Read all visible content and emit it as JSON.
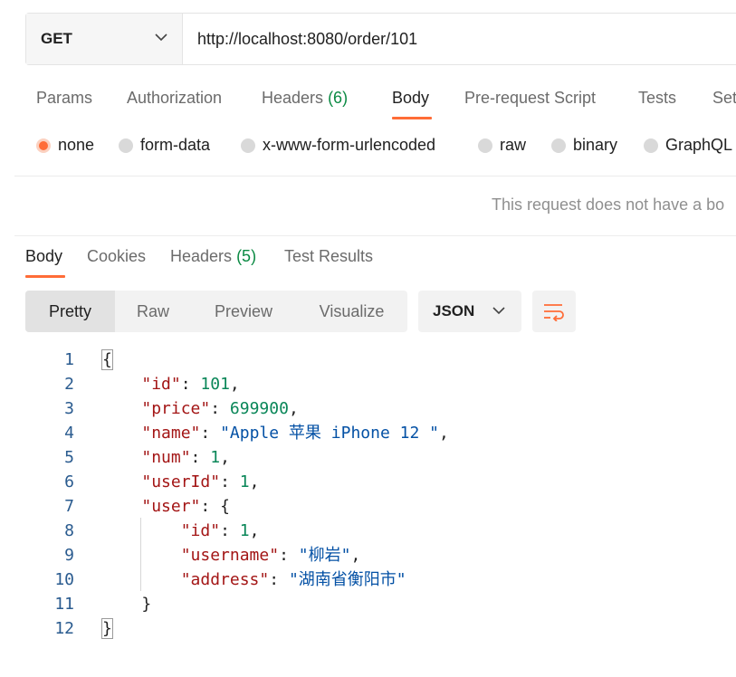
{
  "request": {
    "method": "GET",
    "url": "http://localhost:8080/order/101"
  },
  "request_tabs": [
    {
      "label": "Params",
      "count": ""
    },
    {
      "label": "Authorization",
      "count": ""
    },
    {
      "label": "Headers",
      "count": "(6)"
    },
    {
      "label": "Body",
      "count": "",
      "active": true
    },
    {
      "label": "Pre-request Script",
      "count": ""
    },
    {
      "label": "Tests",
      "count": ""
    },
    {
      "label": "Set",
      "count": ""
    }
  ],
  "body_types": [
    {
      "label": "none",
      "selected": true
    },
    {
      "label": "form-data"
    },
    {
      "label": "x-www-form-urlencoded"
    },
    {
      "label": "raw"
    },
    {
      "label": "binary"
    },
    {
      "label": "GraphQL"
    }
  ],
  "no_body_message": "This request does not have a bo",
  "response_tabs": [
    {
      "label": "Body",
      "count": "",
      "active": true
    },
    {
      "label": "Cookies",
      "count": ""
    },
    {
      "label": "Headers",
      "count": "(5)"
    },
    {
      "label": "Test Results",
      "count": ""
    }
  ],
  "view_modes": [
    {
      "label": "Pretty",
      "active": true
    },
    {
      "label": "Raw"
    },
    {
      "label": "Preview"
    },
    {
      "label": "Visualize"
    }
  ],
  "format": "JSON",
  "icons": {
    "method_dropdown": "chevron-down-icon",
    "format_dropdown": "chevron-down-icon",
    "wrap": "wrap-lines-icon"
  },
  "colors": {
    "accent": "#ff6c37",
    "count": "#0b8a43",
    "json_key": "#a31515",
    "json_number": "#098658",
    "json_string": "#0451a5",
    "line_number": "#2a5b8f"
  },
  "response_lines": [
    {
      "n": "1",
      "indent": 0,
      "parts": [
        [
          "p",
          "{"
        ]
      ]
    },
    {
      "n": "2",
      "indent": 1,
      "parts": [
        [
          "k",
          "\"id\""
        ],
        [
          "p",
          ": "
        ],
        [
          "n",
          "101"
        ],
        [
          "p",
          ","
        ]
      ]
    },
    {
      "n": "3",
      "indent": 1,
      "parts": [
        [
          "k",
          "\"price\""
        ],
        [
          "p",
          ": "
        ],
        [
          "n",
          "699900"
        ],
        [
          "p",
          ","
        ]
      ]
    },
    {
      "n": "4",
      "indent": 1,
      "parts": [
        [
          "k",
          "\"name\""
        ],
        [
          "p",
          ": "
        ],
        [
          "s",
          "\"Apple 苹果 iPhone 12 \""
        ],
        [
          "p",
          ","
        ]
      ]
    },
    {
      "n": "5",
      "indent": 1,
      "parts": [
        [
          "k",
          "\"num\""
        ],
        [
          "p",
          ": "
        ],
        [
          "n",
          "1"
        ],
        [
          "p",
          ","
        ]
      ]
    },
    {
      "n": "6",
      "indent": 1,
      "parts": [
        [
          "k",
          "\"userId\""
        ],
        [
          "p",
          ": "
        ],
        [
          "n",
          "1"
        ],
        [
          "p",
          ","
        ]
      ]
    },
    {
      "n": "7",
      "indent": 1,
      "parts": [
        [
          "k",
          "\"user\""
        ],
        [
          "p",
          ": {"
        ]
      ]
    },
    {
      "n": "8",
      "indent": 2,
      "parts": [
        [
          "k",
          "\"id\""
        ],
        [
          "p",
          ": "
        ],
        [
          "n",
          "1"
        ],
        [
          "p",
          ","
        ]
      ]
    },
    {
      "n": "9",
      "indent": 2,
      "parts": [
        [
          "k",
          "\"username\""
        ],
        [
          "p",
          ": "
        ],
        [
          "s",
          "\"柳岩\""
        ],
        [
          "p",
          ","
        ]
      ]
    },
    {
      "n": "10",
      "indent": 2,
      "parts": [
        [
          "k",
          "\"address\""
        ],
        [
          "p",
          ": "
        ],
        [
          "s",
          "\"湖南省衡阳市\""
        ]
      ]
    },
    {
      "n": "11",
      "indent": 1,
      "parts": [
        [
          "p",
          "}"
        ]
      ]
    },
    {
      "n": "12",
      "indent": 0,
      "parts": [
        [
          "p",
          "}"
        ]
      ]
    }
  ]
}
